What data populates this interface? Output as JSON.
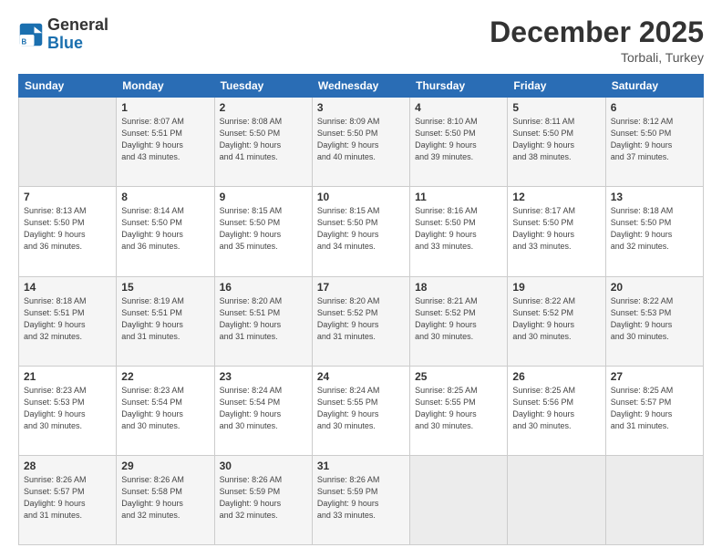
{
  "header": {
    "logo_line1": "General",
    "logo_line2": "Blue",
    "month": "December 2025",
    "location": "Torbali, Turkey"
  },
  "days_of_week": [
    "Sunday",
    "Monday",
    "Tuesday",
    "Wednesday",
    "Thursday",
    "Friday",
    "Saturday"
  ],
  "weeks": [
    [
      {
        "day": "",
        "info": ""
      },
      {
        "day": "1",
        "info": "Sunrise: 8:07 AM\nSunset: 5:51 PM\nDaylight: 9 hours\nand 43 minutes."
      },
      {
        "day": "2",
        "info": "Sunrise: 8:08 AM\nSunset: 5:50 PM\nDaylight: 9 hours\nand 41 minutes."
      },
      {
        "day": "3",
        "info": "Sunrise: 8:09 AM\nSunset: 5:50 PM\nDaylight: 9 hours\nand 40 minutes."
      },
      {
        "day": "4",
        "info": "Sunrise: 8:10 AM\nSunset: 5:50 PM\nDaylight: 9 hours\nand 39 minutes."
      },
      {
        "day": "5",
        "info": "Sunrise: 8:11 AM\nSunset: 5:50 PM\nDaylight: 9 hours\nand 38 minutes."
      },
      {
        "day": "6",
        "info": "Sunrise: 8:12 AM\nSunset: 5:50 PM\nDaylight: 9 hours\nand 37 minutes."
      }
    ],
    [
      {
        "day": "7",
        "info": "Sunrise: 8:13 AM\nSunset: 5:50 PM\nDaylight: 9 hours\nand 36 minutes."
      },
      {
        "day": "8",
        "info": "Sunrise: 8:14 AM\nSunset: 5:50 PM\nDaylight: 9 hours\nand 36 minutes."
      },
      {
        "day": "9",
        "info": "Sunrise: 8:15 AM\nSunset: 5:50 PM\nDaylight: 9 hours\nand 35 minutes."
      },
      {
        "day": "10",
        "info": "Sunrise: 8:15 AM\nSunset: 5:50 PM\nDaylight: 9 hours\nand 34 minutes."
      },
      {
        "day": "11",
        "info": "Sunrise: 8:16 AM\nSunset: 5:50 PM\nDaylight: 9 hours\nand 33 minutes."
      },
      {
        "day": "12",
        "info": "Sunrise: 8:17 AM\nSunset: 5:50 PM\nDaylight: 9 hours\nand 33 minutes."
      },
      {
        "day": "13",
        "info": "Sunrise: 8:18 AM\nSunset: 5:50 PM\nDaylight: 9 hours\nand 32 minutes."
      }
    ],
    [
      {
        "day": "14",
        "info": "Sunrise: 8:18 AM\nSunset: 5:51 PM\nDaylight: 9 hours\nand 32 minutes."
      },
      {
        "day": "15",
        "info": "Sunrise: 8:19 AM\nSunset: 5:51 PM\nDaylight: 9 hours\nand 31 minutes."
      },
      {
        "day": "16",
        "info": "Sunrise: 8:20 AM\nSunset: 5:51 PM\nDaylight: 9 hours\nand 31 minutes."
      },
      {
        "day": "17",
        "info": "Sunrise: 8:20 AM\nSunset: 5:52 PM\nDaylight: 9 hours\nand 31 minutes."
      },
      {
        "day": "18",
        "info": "Sunrise: 8:21 AM\nSunset: 5:52 PM\nDaylight: 9 hours\nand 30 minutes."
      },
      {
        "day": "19",
        "info": "Sunrise: 8:22 AM\nSunset: 5:52 PM\nDaylight: 9 hours\nand 30 minutes."
      },
      {
        "day": "20",
        "info": "Sunrise: 8:22 AM\nSunset: 5:53 PM\nDaylight: 9 hours\nand 30 minutes."
      }
    ],
    [
      {
        "day": "21",
        "info": "Sunrise: 8:23 AM\nSunset: 5:53 PM\nDaylight: 9 hours\nand 30 minutes."
      },
      {
        "day": "22",
        "info": "Sunrise: 8:23 AM\nSunset: 5:54 PM\nDaylight: 9 hours\nand 30 minutes."
      },
      {
        "day": "23",
        "info": "Sunrise: 8:24 AM\nSunset: 5:54 PM\nDaylight: 9 hours\nand 30 minutes."
      },
      {
        "day": "24",
        "info": "Sunrise: 8:24 AM\nSunset: 5:55 PM\nDaylight: 9 hours\nand 30 minutes."
      },
      {
        "day": "25",
        "info": "Sunrise: 8:25 AM\nSunset: 5:55 PM\nDaylight: 9 hours\nand 30 minutes."
      },
      {
        "day": "26",
        "info": "Sunrise: 8:25 AM\nSunset: 5:56 PM\nDaylight: 9 hours\nand 30 minutes."
      },
      {
        "day": "27",
        "info": "Sunrise: 8:25 AM\nSunset: 5:57 PM\nDaylight: 9 hours\nand 31 minutes."
      }
    ],
    [
      {
        "day": "28",
        "info": "Sunrise: 8:26 AM\nSunset: 5:57 PM\nDaylight: 9 hours\nand 31 minutes."
      },
      {
        "day": "29",
        "info": "Sunrise: 8:26 AM\nSunset: 5:58 PM\nDaylight: 9 hours\nand 32 minutes."
      },
      {
        "day": "30",
        "info": "Sunrise: 8:26 AM\nSunset: 5:59 PM\nDaylight: 9 hours\nand 32 minutes."
      },
      {
        "day": "31",
        "info": "Sunrise: 8:26 AM\nSunset: 5:59 PM\nDaylight: 9 hours\nand 33 minutes."
      },
      {
        "day": "",
        "info": ""
      },
      {
        "day": "",
        "info": ""
      },
      {
        "day": "",
        "info": ""
      }
    ]
  ]
}
